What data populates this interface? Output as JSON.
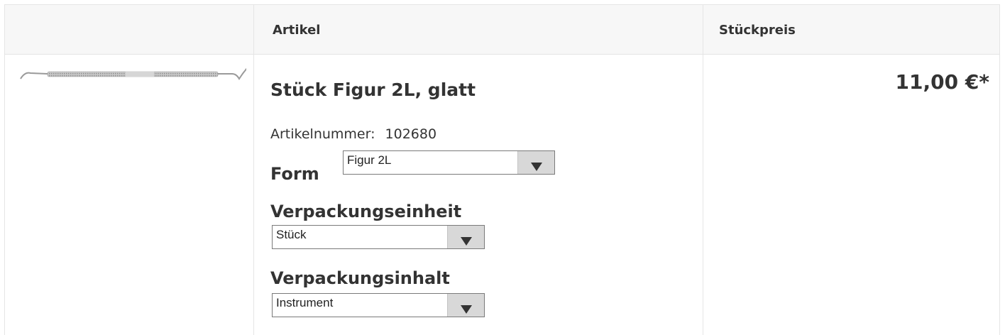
{
  "header": {
    "col_article": "Artikel",
    "col_unit_price": "Stückpreis"
  },
  "product": {
    "title": "Stück Figur 2L, glatt",
    "article_number_label": "Artikelnummer:",
    "article_number": "102680",
    "image": "dental-instrument-image",
    "price": "11,00 €*"
  },
  "options": {
    "form": {
      "label": "Form",
      "selected": "Figur 2L"
    },
    "packaging_unit": {
      "label": "Verpackungseinheit",
      "selected": "Stück"
    },
    "packaging_content": {
      "label": "Verpackungsinhalt",
      "selected": "Instrument"
    }
  },
  "icons": {
    "dropdown": "chevron-down-icon"
  }
}
